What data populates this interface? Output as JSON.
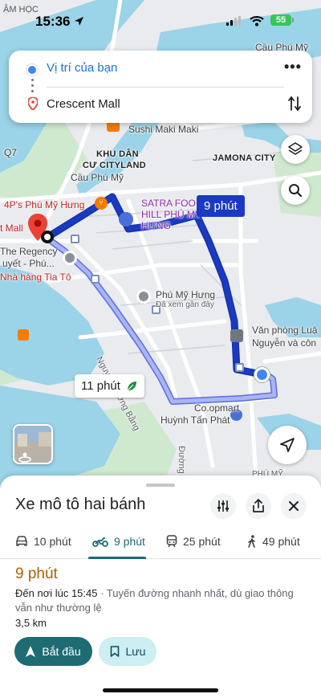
{
  "status_bar": {
    "carrier": "ẬM HỌC",
    "time": "15:36",
    "battery": "55",
    "icons": [
      "location-arrow-icon",
      "signal-icon",
      "wifi-icon",
      "battery-icon"
    ]
  },
  "search": {
    "origin": "Vị trí của bạn",
    "destination": "Crescent Mall",
    "more_icon": "more-horizontal-icon",
    "swap_icon": "swap-vertical-icon"
  },
  "map": {
    "labels": {
      "cau_phu_my_top": "Cầu Phú Mỹ",
      "q7": "Q7",
      "sushi": "Sushi Maki Maki",
      "khu_dan_cu_line1": "KHU DÂN",
      "khu_dan_cu_line2": "CƯ CITYLAND",
      "jamona": "JAMONA CITY",
      "cau_phu_my_mid": "Cầu Phú Mỹ",
      "four_ps": "4P's Phú Mỹ Hưng",
      "satra_line1": "SATRA FOO",
      "satra_line2": "HILL PHÚ MỸ",
      "satra_line3": "HƯNG",
      "t_mall": "t Mall",
      "regency_line1": "The Regency",
      "regency_line2": "uyết - Phú...",
      "phu_my_hung": "Phú Mỹ Hưng",
      "da_xem": "Đã xem gần đây",
      "van_phong_line1": "Văn phòng Luậ",
      "van_phong_line2": "Nguyễn và côn",
      "nha_hang": "Nhà hàng Tia Tô",
      "nguyen_luong_bang": "Nguyễn Lương Bằng",
      "coopmart_line1": "Co.opmart",
      "coopmart_line2": "Huỳnh Tấn Phát",
      "duong": "Đường",
      "phu_my_bottom": "PHÚ MỸ"
    },
    "route_badge_primary": "9 phút",
    "route_badge_alt": "11 phút",
    "colors": {
      "route": "#1a3ac4",
      "route_alt": "#a8b6f0",
      "water": "#9bd3e8",
      "park": "#c9e8c9"
    }
  },
  "controls": {
    "layers_icon": "layers-icon",
    "search_icon": "search-icon",
    "navigate_icon": "navigation-arrow-icon",
    "streetview_icon": "street-view-icon"
  },
  "sheet": {
    "title": "Xe mô tô hai bánh",
    "actions": [
      "options-icon",
      "share-icon",
      "close-icon"
    ],
    "tabs": [
      {
        "icon": "car-icon",
        "label": "10 phút",
        "active": false
      },
      {
        "icon": "motorcycle-icon",
        "label": "9 phút",
        "active": true
      },
      {
        "icon": "transit-icon",
        "label": "25 phút",
        "active": false
      },
      {
        "icon": "walk-icon",
        "label": "49 phút",
        "active": false
      }
    ],
    "route_time": "9 phút",
    "arrival": "Đến nơi lúc 15:45",
    "description": " · Tuyến đường nhanh nhất, dù giao thông vẫn như thường lệ",
    "distance": "3,5 km",
    "start_label": "Bắt đầu",
    "save_label": "Lưu",
    "accent": "#1e6b74"
  }
}
